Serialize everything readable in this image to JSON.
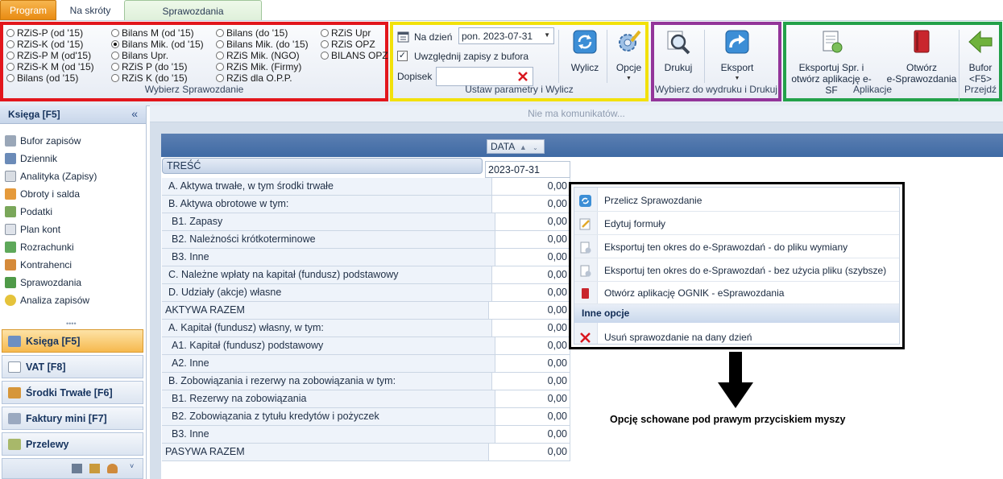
{
  "tabs": {
    "program": "Program",
    "shortcuts": "Na skróty",
    "reports": "Sprawozdania"
  },
  "ribbon": {
    "select_group": {
      "label": "Wybierz Sprawozdanie",
      "col1": [
        "RZiS-P (od '15)",
        "RZiS-K (od '15)",
        "RZiS-P M (od'15)",
        "RZiS-K M (od '15)",
        "Bilans (od '15)"
      ],
      "col2": [
        "Bilans M (od '15)",
        "Bilans Mik. (od '15)",
        "Bilans Upr.",
        "RZiS P (do '15)",
        "RZiS K (do '15)"
      ],
      "col3": [
        "Bilans (do '15)",
        "Bilans Mik. (do '15)",
        "RZiS Mik. (NGO)",
        "RZiS Mik. (Firmy)",
        "RZiS dla O.P.P."
      ],
      "col4": [
        "RZiS Upr",
        "RZiS OPZ",
        "BILANS OPZ"
      ],
      "selected": "Bilans Mik. (od '15)"
    },
    "params_group": {
      "label": "Ustaw parametry i Wylicz",
      "date_label": "Na dzień",
      "date_value": "pon. 2023-07-31",
      "buffer_label": "Uwzględnij zapisy z bufora",
      "buffer_checked": true,
      "note_label": "Dopisek",
      "calc_label": "Wylicz",
      "options_label": "Opcje"
    },
    "print_group": {
      "label": "Wybierz do wydruku i Drukuj",
      "print_label": "Drukuj",
      "export_label": "Eksport"
    },
    "apps_group": {
      "label": "Aplikacje",
      "export_sf_line1": "Eksportuj Spr. i",
      "export_sf_line2": "otwórz aplikację e-SF",
      "open_line1": "Otwórz",
      "open_line2": "e-Sprawozdania"
    },
    "goto_group": {
      "label": "Przejdź",
      "buffer_line1": "Bufor",
      "buffer_line2": "<F5>"
    }
  },
  "leftnav": {
    "header": "Księga [F5]",
    "items": [
      "Bufor zapisów",
      "Dziennik",
      "Analityka (Zapisy)",
      "Obroty i salda",
      "Podatki",
      "Plan kont",
      "Rozrachunki",
      "Kontrahenci",
      "Sprawozdania",
      "Analiza zapisów"
    ],
    "modules": [
      "Księga [F5]",
      "VAT [F8]",
      "Środki Trwałe [F6]",
      "Faktury mini [F7]",
      "Przelewy"
    ]
  },
  "main": {
    "message": "Nie ma komunikatów...",
    "col_date_header": "DATA",
    "col_tresc_header": "TREŚĆ",
    "date_value": "2023-07-31",
    "rows": [
      {
        "label": "A. Aktywa trwałe, w tym środki trwałe",
        "value": "0,00"
      },
      {
        "label": "B. Aktywa obrotowe w tym:",
        "value": "0,00"
      },
      {
        "label": "B1. Zapasy",
        "value": "0,00"
      },
      {
        "label": "B2. Należności krótkoterminowe",
        "value": "0,00"
      },
      {
        "label": "B3. Inne",
        "value": "0,00"
      },
      {
        "label": "C. Należne wpłaty na kapitał (fundusz) podstawowy",
        "value": "0,00"
      },
      {
        "label": "D. Udziały (akcje) własne",
        "value": "0,00"
      },
      {
        "label": "AKTYWA RAZEM",
        "value": "0,00"
      },
      {
        "label": "A. Kapitał (fundusz) własny, w tym:",
        "value": "0,00"
      },
      {
        "label": "A1. Kapitał (fundusz) podstawowy",
        "value": "0,00"
      },
      {
        "label": "A2. Inne",
        "value": "0,00"
      },
      {
        "label": "B. Zobowiązania i rezerwy na zobowiązania w tym:",
        "value": "0,00"
      },
      {
        "label": "B1. Rezerwy na zobowiązania",
        "value": "0,00"
      },
      {
        "label": "B2. Zobowiązania z tytułu kredytów i pożyczek",
        "value": "0,00"
      },
      {
        "label": "B3. Inne",
        "value": "0,00"
      },
      {
        "label": "PASYWA RAZEM",
        "value": "0,00"
      }
    ]
  },
  "context_menu": {
    "items": [
      "Przelicz Sprawozdanie",
      "Edytuj formuły",
      "Eksportuj ten okres do e-Sprawozdań - do pliku wymiany",
      "Eksportuj ten okres do e-Sprawozdań - bez użycia pliku (szybsze)",
      "Otwórz aplikację OGNIK - eSprawozdania"
    ],
    "section": "Inne opcje",
    "delete_item": "Usuń sprawozdanie na dany dzień"
  },
  "annotation": "Opcję schowane pod prawym przyciskiem myszy",
  "colors": {
    "red_frame": "#e2161c",
    "yellow_frame": "#f2e10a",
    "purple_frame": "#93359a",
    "green_frame": "#23a14a",
    "program_tab": "#e98b12"
  }
}
